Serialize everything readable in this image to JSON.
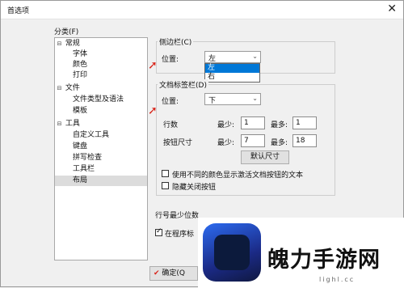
{
  "window": {
    "title": "首选项",
    "close_icon": "close-icon"
  },
  "sidebar": {
    "label": "分类(F)",
    "items": [
      {
        "label": "常规",
        "toggle": "⊟",
        "level": 0
      },
      {
        "label": "字体",
        "level": 1
      },
      {
        "label": "颜色",
        "level": 1
      },
      {
        "label": "打印",
        "level": 1
      },
      {
        "label": "文件",
        "toggle": "⊟",
        "level": 0
      },
      {
        "label": "文件类型及语法",
        "level": 1
      },
      {
        "label": "模板",
        "level": 1
      },
      {
        "label": "工具",
        "toggle": "⊟",
        "level": 0
      },
      {
        "label": "自定义工具",
        "level": 1
      },
      {
        "label": "键盘",
        "level": 1
      },
      {
        "label": "拼写检查",
        "level": 1
      },
      {
        "label": "工具栏",
        "level": 1
      },
      {
        "label": "布局",
        "level": 1,
        "selected": true
      }
    ]
  },
  "sidebar_group": {
    "title": "侧边栏(C)",
    "position_label": "位置:",
    "position_value": "左",
    "dropdown_options": [
      "左",
      "右"
    ],
    "highlighted_option": "左"
  },
  "tabbar_group": {
    "title": "文档标签栏(D)",
    "position_label": "位置:",
    "position_value": "下",
    "rows_label": "行数",
    "button_size_label": "按钮尺寸",
    "min_label": "最少:",
    "max_label": "最多:",
    "rows_min": "1",
    "rows_max": "1",
    "btn_min": "7",
    "btn_max": "18",
    "default_size_button": "默认尺寸",
    "check_colors": "使用不同的颜色显示激活文档按钮的文本",
    "check_hide_close": "隐藏关闭按钮"
  },
  "lower": {
    "line_number_label": "行号最少位数",
    "program_check_label": "在程序标",
    "program_check_checked": true
  },
  "footer": {
    "ok_button": "确定(Q"
  },
  "watermark": {
    "name": "魄力手游网",
    "url": "lighl.cc"
  },
  "colors": {
    "accent": "#0078d7",
    "annotation_arrow": "#d9261c"
  }
}
